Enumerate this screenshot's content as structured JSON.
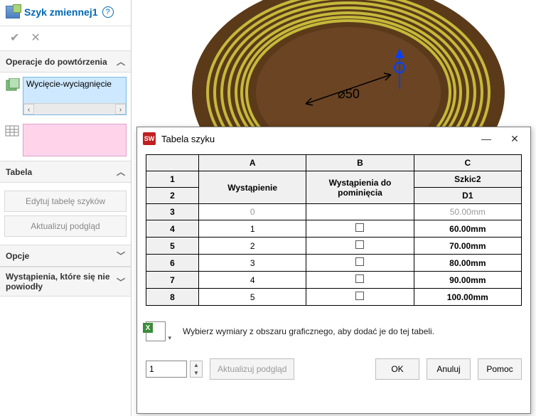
{
  "panel": {
    "title": "Szyk zmiennej1",
    "sections": {
      "operations": {
        "title": "Operacje do powtórzenia",
        "item": "Wycięcie-wyciągnięcie"
      },
      "table": {
        "title": "Tabela",
        "edit_btn": "Edytuj tabelę szyków",
        "preview_btn": "Aktualizuj podgląd"
      },
      "options": {
        "title": "Opcje"
      },
      "failed": {
        "title": "Wystąpienia, które się nie powiodły"
      }
    }
  },
  "graphic": {
    "dim_label": "⌀50"
  },
  "dialog": {
    "title": "Tabela szyku",
    "colA": "A",
    "colB": "B",
    "colC": "C",
    "hdr_instance": "Wystąpienie",
    "hdr_skip": "Wystąpienia do pominięcia",
    "hdr_sketch": "Szkic2",
    "hdr_d1": "D1",
    "rows": [
      {
        "n": "3",
        "inst": "0",
        "skip": "",
        "d1": "50.00mm",
        "grey": true
      },
      {
        "n": "4",
        "inst": "1",
        "skip": "cb",
        "d1": "60.00mm"
      },
      {
        "n": "5",
        "inst": "2",
        "skip": "cb",
        "d1": "70.00mm"
      },
      {
        "n": "6",
        "inst": "3",
        "skip": "cb",
        "d1": "80.00mm"
      },
      {
        "n": "7",
        "inst": "4",
        "skip": "cb",
        "d1": "90.00mm"
      },
      {
        "n": "8",
        "inst": "5",
        "skip": "cb",
        "d1": "100.00mm"
      }
    ],
    "r1": "1",
    "r2": "2",
    "hint": "Wybierz wymiary z obszaru graficznego, aby dodać je do tej tabeli.",
    "spin_value": "1",
    "preview_btn": "Aktualizuj podgląd",
    "ok": "OK",
    "cancel": "Anuluj",
    "help": "Pomoc"
  }
}
